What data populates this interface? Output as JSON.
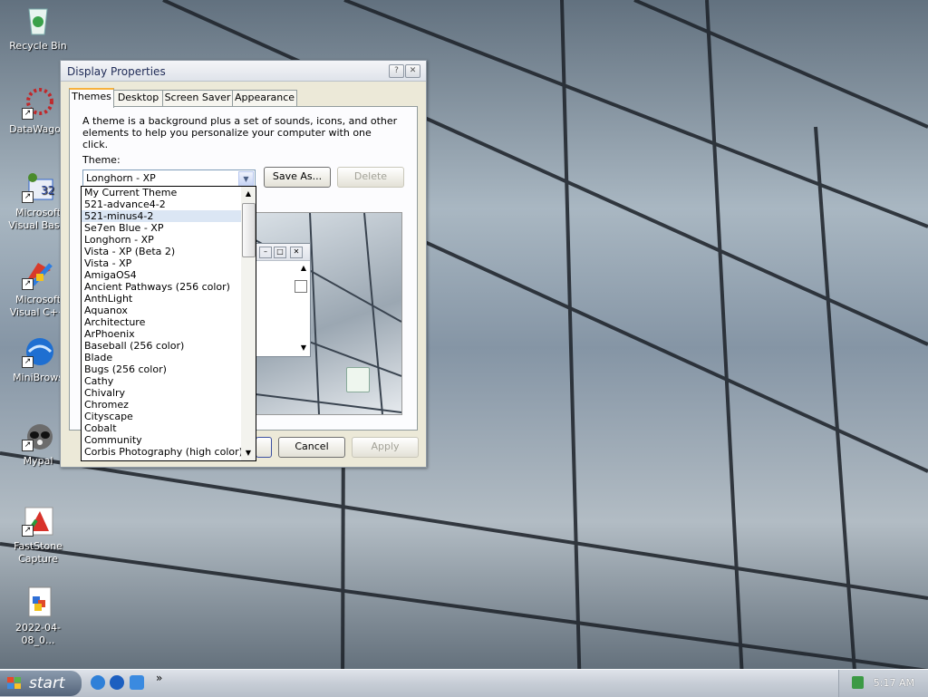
{
  "desktop": {
    "icons": [
      {
        "label": "Recycle Bin"
      },
      {
        "label": "DataWagon"
      },
      {
        "label": "Microsoft Visual Basic"
      },
      {
        "label": "Microsoft Visual C++"
      },
      {
        "label": "MiniBrows"
      },
      {
        "label": "Mypal"
      },
      {
        "label": "FastStone Capture"
      },
      {
        "label": "2022-04-08_0..."
      }
    ]
  },
  "window": {
    "title": "Display Properties",
    "tabs": [
      {
        "label": "Themes"
      },
      {
        "label": "Desktop"
      },
      {
        "label": "Screen Saver"
      },
      {
        "label": "Appearance"
      }
    ],
    "description": "A theme is a background plus a set of sounds, icons, and other elements to help you personalize your computer with one click.",
    "theme_label": "Theme:",
    "theme_selected": "Longhorn - XP",
    "save_as": "Save As...",
    "delete": "Delete",
    "cancel": "Cancel",
    "apply": "Apply",
    "dropdown_items": [
      "My Current Theme",
      "521-advance4-2",
      "521-minus4-2",
      "Se7en Blue - XP",
      "Longhorn - XP",
      "Vista - XP (Beta 2)",
      "Vista - XP",
      "AmigaOS4",
      "Ancient Pathways (256 color)",
      "AnthLight",
      "Aquanox",
      "Architecture",
      "ArPhoenix",
      "Baseball (256 color)",
      "Blade",
      "Bugs (256 color)",
      "Cathy",
      "Chivalry",
      "Chromez",
      "Cityscape",
      "Cobalt",
      "Community",
      "Corbis Photography (high color)"
    ],
    "highlighted_index": 2
  },
  "taskbar": {
    "start": "start",
    "more": "»",
    "clock": "5:17 AM"
  }
}
